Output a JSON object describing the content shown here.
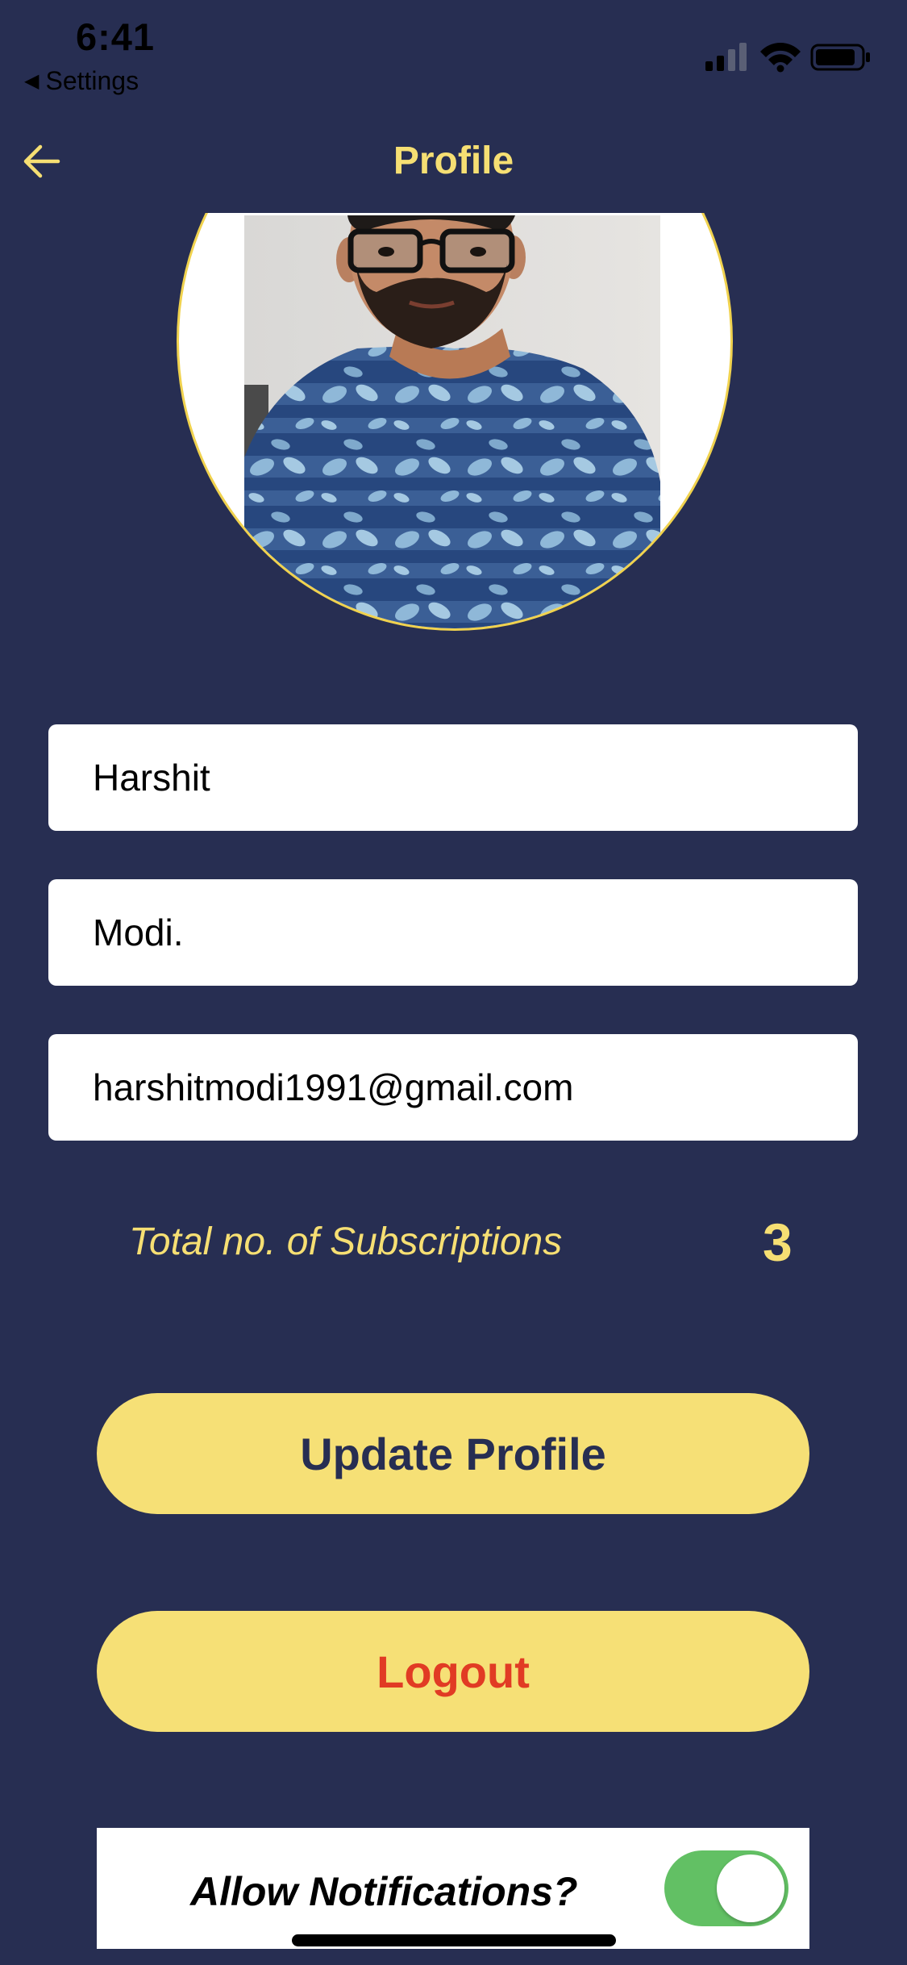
{
  "status_bar": {
    "time": "6:41",
    "back_app": "Settings",
    "icons": [
      "signal-icon",
      "wifi-icon",
      "battery-icon"
    ]
  },
  "header": {
    "title": "Profile",
    "back_icon": "arrow-left-icon"
  },
  "profile": {
    "first_name": "Harshit",
    "last_name": "Modi.",
    "email": "harshitmodi1991@gmail.com"
  },
  "subscriptions": {
    "label": "Total no. of Subscriptions",
    "count": "3"
  },
  "actions": {
    "update_label": "Update Profile",
    "logout_label": "Logout"
  },
  "notifications": {
    "label": "Allow Notifications?",
    "enabled": true
  },
  "colors": {
    "background": "#272e52",
    "accent": "#f6df73",
    "button": "#f6e076",
    "logout_text": "#e13b24",
    "toggle_on": "#62c064"
  }
}
